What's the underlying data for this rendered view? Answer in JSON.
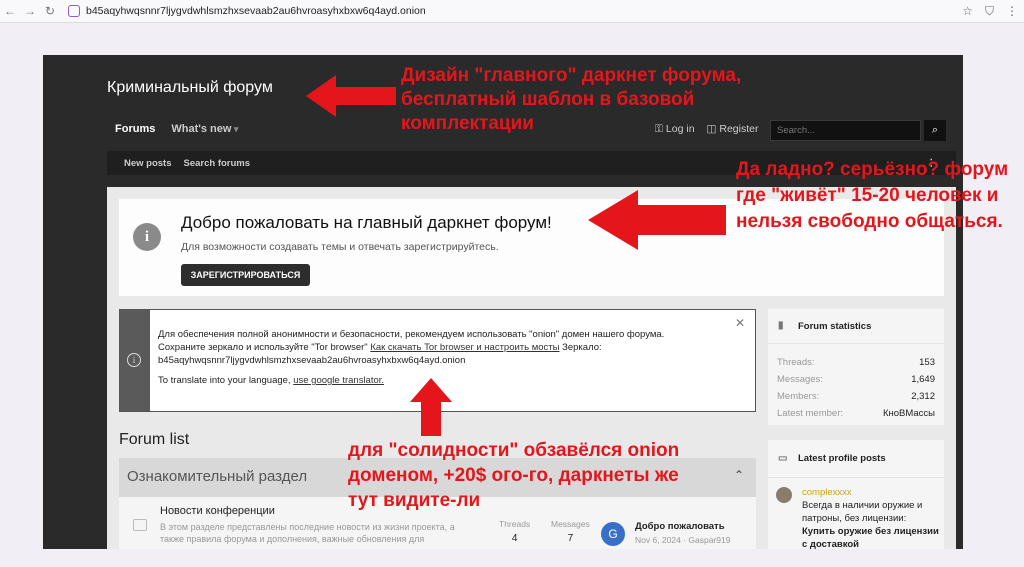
{
  "browser": {
    "url": "b45aqyhwqsnnr7ljygvdwhlsmzhxsevaab2au6hvroasyhxbxw6q4ayd.onion"
  },
  "site": {
    "title": "Криминальный форум"
  },
  "topnav": {
    "forums": "Forums",
    "whats_new": "What's new",
    "login": "Log in",
    "register": "Register",
    "search_placeholder": "Search..."
  },
  "subnav": {
    "new_posts": "New posts",
    "search_forums": "Search forums"
  },
  "welcome": {
    "heading": "Добро пожаловать на главный даркнет форум!",
    "text": "Для возможности создавать темы и отвечать зарегистрируйтесь.",
    "button": "ЗАРЕГИСТРИРОВАТЬСЯ"
  },
  "anon_notice": {
    "line1": "Для обеспечения полной анонимности и безопасности, рекомендуем использовать \"onion\" домен нашего форума.",
    "line2_pre": "Сохраните зеркало и используйте \"Tor browser\"",
    "line2_link": "Как скачать Tor browser и настроить мосты",
    "line2_post": "Зеркало:",
    "line3": "b45aqyhwqsnnr7ljygvdwhlsmzhxsevaab2au6hvroasyhxbxw6q4ayd.onion",
    "line4_pre": "To translate into your language,",
    "line4_link": "use google translator."
  },
  "forum_list": {
    "title": "Forum list",
    "category": "Ознакомительный раздел",
    "forum_name": "Новости конференции",
    "forum_desc": "В этом разделе представлены последние новости из жизни проекта, а также правила форума и дополнения, важные обновления для",
    "threads_label": "Threads",
    "threads_value": "4",
    "messages_label": "Messages",
    "messages_value": "7",
    "last_avatar_letter": "G",
    "last_title": "Добро пожаловать",
    "last_meta": "Nov 6, 2024 · Gaspar919"
  },
  "stats": {
    "title": "Forum statistics",
    "rows": [
      {
        "k": "Threads:",
        "v": "153"
      },
      {
        "k": "Messages:",
        "v": "1,649"
      },
      {
        "k": "Members:",
        "v": "2,312"
      },
      {
        "k": "Latest member:",
        "v": "КноВМассы"
      }
    ]
  },
  "profile_posts": {
    "title": "Latest profile posts",
    "user": "complexxxx",
    "text": "Всегда в наличии оружие и патроны, без лицензии:",
    "bold": "Купить оружие без лицензии с доставкой"
  },
  "annotations": {
    "a1": "Дизайн \"главного\" даркнет форума, бесплатный шаблон в базовой комплектации",
    "a2": "Да ладно? серьёзно? форум где \"живёт\" 15-20 человек и нельзя свободно общаться.",
    "a3": "для \"солидности\" обзавёлся onion доменом, +20$ ого-го, даркнеты же тут видите-ли",
    "color": "#e4161c"
  }
}
